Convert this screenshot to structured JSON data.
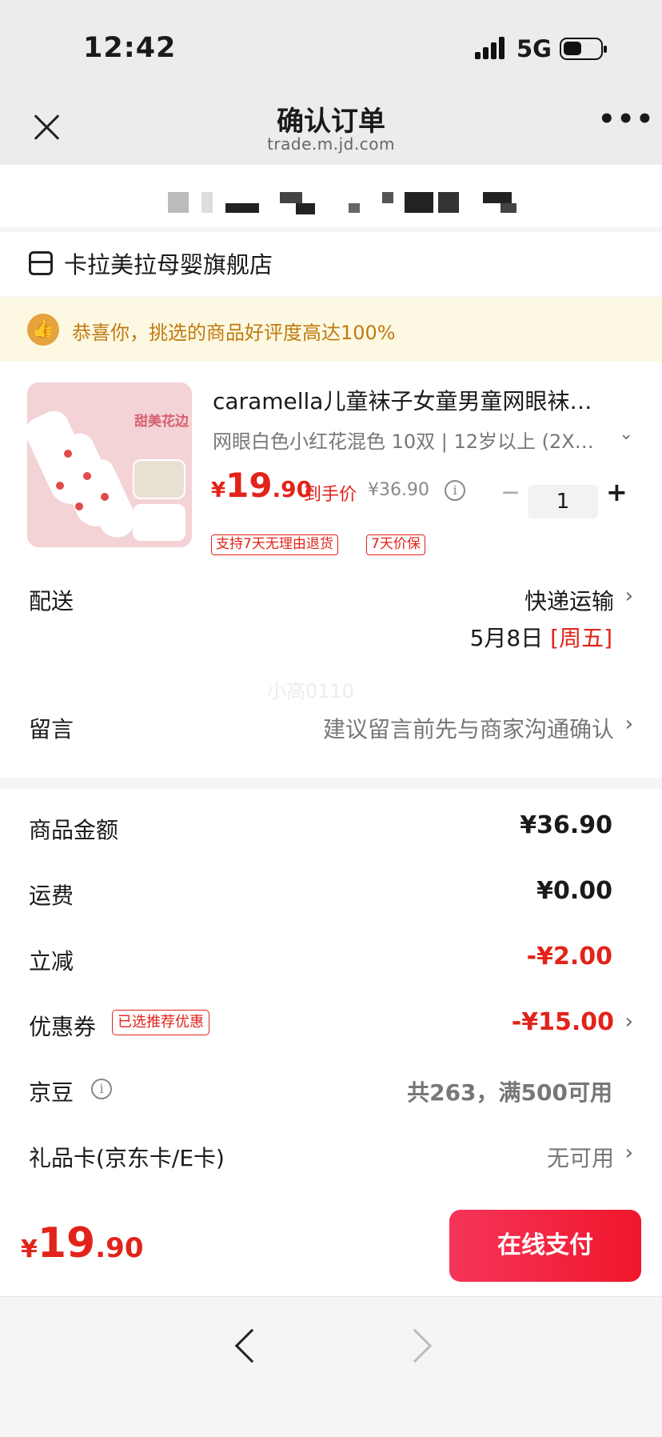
{
  "status_bar": {
    "time": "12:42",
    "network": "5G"
  },
  "nav": {
    "title": "确认订单",
    "url": "trade.m.jd.com",
    "more": "•••"
  },
  "shop": {
    "name": "卡拉美拉母婴旗舰店"
  },
  "notice": {
    "text": "恭喜你，挑选的商品好评度高达100%",
    "icon": "thumbs-up-icon"
  },
  "product": {
    "title": "caramella儿童袜子女童男童网眼袜…",
    "spec": "网眼白色小红花混色 10双 | 12岁以上 (2X…",
    "image_label": "甜美花边",
    "price_currency": "¥",
    "price_int": "19",
    "price_dec": ".90",
    "price_label": "到手价",
    "original_price": "¥36.90",
    "quantity": "1",
    "tags": [
      "支持7天无理由退货",
      "7天价保"
    ]
  },
  "delivery": {
    "label": "配送",
    "method": "快递运输",
    "date": "5月8日",
    "weekday": "[周五]"
  },
  "watermark": "小高0110",
  "message": {
    "label": "留言",
    "placeholder": "建议留言前先与商家沟通确认"
  },
  "summary": [
    {
      "label": "商品金额",
      "value": "¥36.90"
    },
    {
      "label": "运费",
      "value": "¥0.00"
    },
    {
      "label": "立减",
      "value": "-¥2.00"
    },
    {
      "label": "优惠券",
      "tag": "已选推荐优惠",
      "value": "-¥15.00"
    },
    {
      "label": "京豆",
      "value": "共263，满500可用"
    },
    {
      "label": "礼品卡(京东卡/E卡)",
      "value": "无可用"
    }
  ],
  "footer": {
    "currency": "¥",
    "total_int": "19",
    "total_dec": ".90",
    "pay_label": "在线支付"
  },
  "colors": {
    "accent_red": "#e2231a",
    "notice_bg": "#fdf8e1",
    "notice_text": "#c07a12"
  }
}
